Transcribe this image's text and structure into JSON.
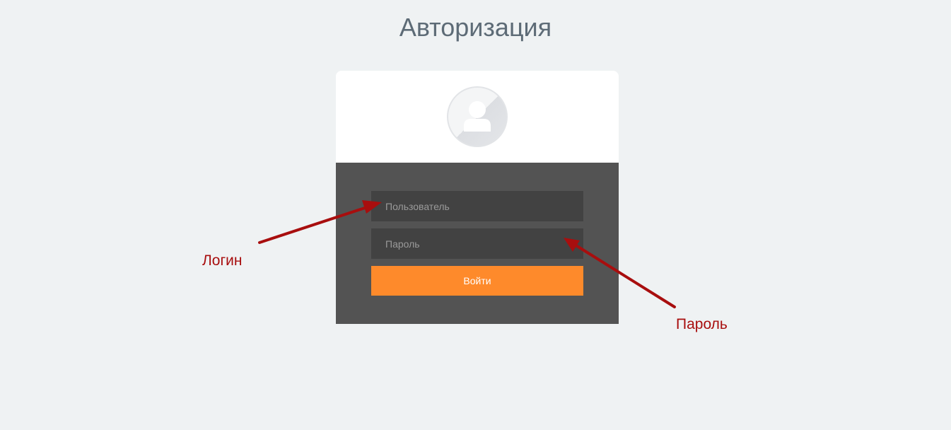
{
  "page": {
    "title": "Авторизация"
  },
  "login_form": {
    "avatar_icon": "user-avatar-icon",
    "username_placeholder": "Пользователь",
    "username_value": "",
    "password_placeholder": "Пароль",
    "password_value": "",
    "submit_label": "Войти"
  },
  "annotations": {
    "login_label": "Логин",
    "password_label": "Пароль",
    "arrow_color": "#a80e0e"
  },
  "colors": {
    "background": "#eff2f3",
    "title": "#5d6b76",
    "card_body": "#535353",
    "input_background": "#424242",
    "button": "#fe8a2b"
  }
}
